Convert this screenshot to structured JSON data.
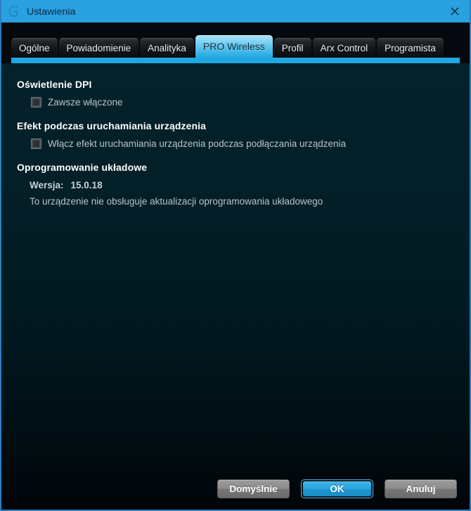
{
  "window": {
    "title": "Ustawienia",
    "logo_icon": "logitech-g-logo-icon",
    "close_icon": "close-icon",
    "accent_color": "#29a0e0",
    "titlebar_color": "#29a0e0",
    "content_bg_color": "#021a22"
  },
  "tabs": [
    {
      "label": "Ogólne",
      "selected": false
    },
    {
      "label": "Powiadomienie",
      "selected": false
    },
    {
      "label": "Analityka",
      "selected": false
    },
    {
      "label": "PRO Wireless",
      "selected": true
    },
    {
      "label": "Profil",
      "selected": false
    },
    {
      "label": "Arx Control",
      "selected": false
    },
    {
      "label": "Programista",
      "selected": false
    }
  ],
  "sections": [
    {
      "title": "Oświetlenie DPI",
      "checkboxes": [
        {
          "label": "Zawsze włączone",
          "checked": false
        }
      ]
    },
    {
      "title": "Efekt podczas uruchamiania urządzenia",
      "checkboxes": [
        {
          "label": "Włącz efekt uruchamiania urządzenia podczas podłączania urządzenia",
          "checked": false
        }
      ]
    }
  ],
  "firmware": {
    "title": "Oprogramowanie układowe",
    "version_label": "Wersja:",
    "version_value": "15.0.18",
    "note": "To urządzenie nie obsługuje aktualizacji oprogramowania układowego"
  },
  "footer": {
    "defaults_label": "Domyślnie",
    "ok_label": "OK",
    "cancel_label": "Anuluj"
  }
}
